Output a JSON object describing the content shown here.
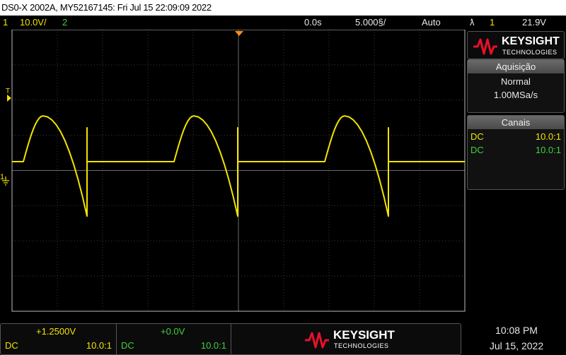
{
  "title_bar": {
    "text": "DS0-X 2002A, MY52167145: Fri Jul 15 22:09:09 2022"
  },
  "status_bar": {
    "ch1_number": "1",
    "ch1_scale": "10.0V/",
    "ch2_number": "2",
    "time_offset": "0.0s",
    "time_scale": "5.000§/",
    "trigger_mode": "Auto",
    "trigger_symbol": "ƛ",
    "trigger_source": "1",
    "trigger_level": "21.9V"
  },
  "screen": {
    "ch1_marker": "1",
    "trigger_marker": "T"
  },
  "side_panel": {
    "brand": {
      "name": "KEYSIGHT",
      "sub": "TECHNOLOGIES"
    },
    "acquisition": {
      "title": "Aquisição",
      "mode": "Normal",
      "rate": "1.00MSa/s"
    },
    "channels": {
      "title": "Canais",
      "rows": [
        {
          "coupling": "DC",
          "probe": "10.0:1",
          "color": "#f2e400"
        },
        {
          "coupling": "DC",
          "probe": "10.0:1",
          "color": "#3fd13f"
        }
      ]
    }
  },
  "bottom_bar": {
    "ch1": {
      "offset": "+1.2500V",
      "coupling": "DC",
      "probe": "10.0:1"
    },
    "ch2": {
      "offset": "+0.0V",
      "coupling": "DC",
      "probe": "10.0:1"
    },
    "brand": {
      "name": "KEYSIGHT",
      "sub": "TECHNOLOGIES"
    }
  },
  "clock": {
    "time": "10:08 PM",
    "date": "Jul 15, 2022"
  },
  "colors": {
    "ch1": "#f2e400",
    "ch2": "#3fd13f",
    "trigger": "#ff8c1a",
    "accent": "#e8102a"
  },
  "waveform": {
    "ch1": {
      "period_div": 3.6,
      "baseline_div": 0.25,
      "peak_div": 1.55,
      "dip_div": -1.3,
      "segments": [
        "flat",
        "rise",
        "fall",
        "flat"
      ]
    }
  }
}
